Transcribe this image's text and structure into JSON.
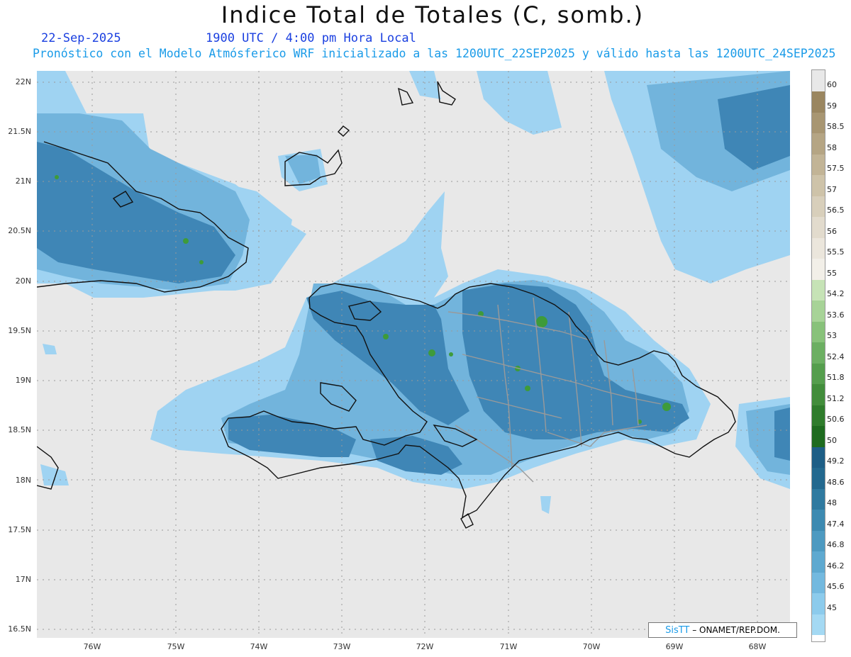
{
  "header": {
    "title": "Indice Total de Totales (C, somb.)",
    "date": "22-Sep-2025",
    "time": "1900 UTC / 4:00 pm Hora Local",
    "subtitle": "Pronóstico con el Modelo Atmósferico WRF inicializado a las 1200UTC_22SEP2025 y válido hasta las  1200UTC_24SEP2025"
  },
  "axes": {
    "lat_labels": [
      "22N",
      "21.5N",
      "21N",
      "20.5N",
      "20N",
      "19.5N",
      "19N",
      "18.5N",
      "18N",
      "17.5N",
      "17N",
      "16.5N"
    ],
    "lon_labels": [
      "76W",
      "75W",
      "74W",
      "73W",
      "72W",
      "71W",
      "70W",
      "69W",
      "68W"
    ]
  },
  "colorbar": {
    "labels": [
      "60",
      "59",
      "58.5",
      "58",
      "57.5",
      "57",
      "56.5",
      "56",
      "55.5",
      "55",
      "54.2",
      "53.6",
      "53",
      "52.4",
      "51.8",
      "51.2",
      "50.6",
      "50",
      "49.2",
      "48.6",
      "48",
      "47.4",
      "46.8",
      "46.2",
      "45.6",
      "45"
    ],
    "colors": [
      "#9a8660",
      "#a89672",
      "#b5a584",
      "#c2b496",
      "#cec3a9",
      "#d8cfbb",
      "#e2dbcd",
      "#ebe6dc",
      "#f2efe8",
      "#c6e3b6",
      "#a7d397",
      "#88c27a",
      "#6caf62",
      "#559e4d",
      "#428d3b",
      "#2f7c2c",
      "#1e6b1f",
      "#1d5e86",
      "#23698f",
      "#2f7aa0",
      "#3d8ab1",
      "#4d9ac1",
      "#5ea9d0",
      "#73b9df",
      "#8ccbec",
      "#a4d9f3"
    ]
  },
  "credit": {
    "logo": "SisTT",
    "text": " – ONAMET/REP.DOM."
  },
  "legend_colors": {
    "background": "#e8e8e8",
    "light": "#9fd3f2",
    "medium": "#72b4dc",
    "dark": "#3f86b6",
    "green": "#3e9b3a",
    "coast": "#111111",
    "border": "#9a9a9a"
  }
}
